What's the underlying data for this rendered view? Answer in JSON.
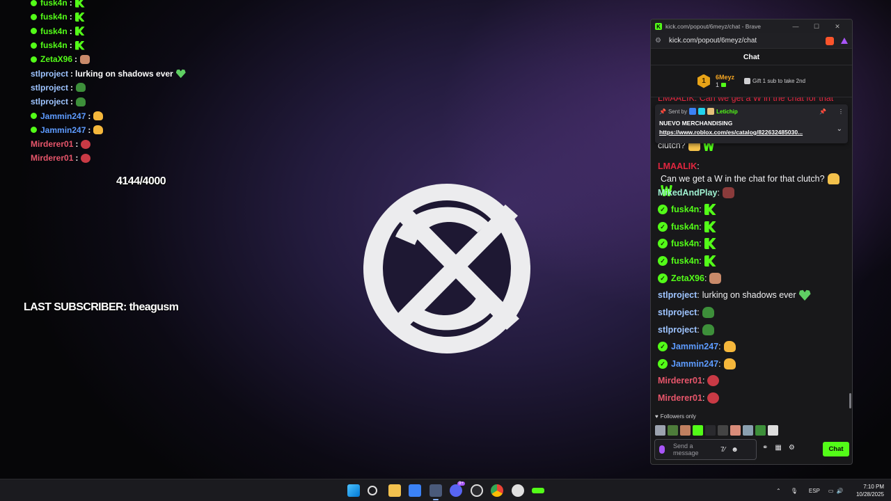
{
  "overlay": {
    "chat": [
      {
        "user": "fusk4n",
        "verified": true,
        "color": "#53fc18",
        "text": "",
        "emote": "kick"
      },
      {
        "user": "fusk4n",
        "verified": true,
        "color": "#53fc18",
        "text": "",
        "emote": "kick"
      },
      {
        "user": "fusk4n",
        "verified": true,
        "color": "#53fc18",
        "text": "",
        "emote": "kick"
      },
      {
        "user": "fusk4n",
        "verified": true,
        "color": "#53fc18",
        "text": "",
        "emote": "kick"
      },
      {
        "user": "ZetaX96",
        "verified": true,
        "color": "#53fc18",
        "text": "",
        "emote": "cat"
      },
      {
        "user": "stlproject",
        "verified": false,
        "color": "#9ec4ff",
        "text": "lurking on shadows ever",
        "emote": "heart"
      },
      {
        "user": "stlproject",
        "verified": false,
        "color": "#9ec4ff",
        "text": "",
        "emote": "pepe"
      },
      {
        "user": "stlproject",
        "verified": false,
        "color": "#9ec4ff",
        "text": "",
        "emote": "pepe"
      },
      {
        "user": "Jammin247",
        "verified": true,
        "color": "#5d9bff",
        "text": "",
        "emote": "duck"
      },
      {
        "user": "Jammin247",
        "verified": true,
        "color": "#5d9bff",
        "text": "",
        "emote": "duck"
      },
      {
        "user": "Mirderer01",
        "verified": false,
        "color": "#e8566b",
        "text": "",
        "emote": "skull"
      },
      {
        "user": "Mirderer01",
        "verified": false,
        "color": "#e8566b",
        "text": "",
        "emote": "skull"
      }
    ],
    "counter": "4144/4000",
    "last_subscriber": "LAST SUBSCRIBER: theagusm"
  },
  "browser": {
    "window_title": "kick.com/popout/6meyz/chat - Brave",
    "url": "kick.com/popout/6meyz/chat",
    "chat_header": "Chat",
    "leaderboard": {
      "rank": "1",
      "user": "6Meyz",
      "count": "1",
      "gift_text": "Gift 1 sub to take 2nd"
    },
    "partial_message": "LMAALIK: Can we get a W in the chat for that",
    "pinned": {
      "sent_by": "Sent by",
      "sender": "Letichip",
      "title": "NUEVO MERCHANDISING",
      "link": "https://www.roblox.com/es/catalog/822632485030..."
    },
    "messages": [
      {
        "user": "",
        "verified": false,
        "color": "#ffffff",
        "text": "clutch?",
        "emotes": [
          "hands",
          "w"
        ]
      },
      {
        "user": "LMAALIK",
        "verified": false,
        "color": "#e2263f",
        "text": "Can we get a W in the chat for that clutch?",
        "emotes": [
          "hands",
          "w"
        ]
      },
      {
        "user": "MikedAndPlay",
        "verified": false,
        "color": "#9ff0d0",
        "text": "",
        "emotes": [
          "face"
        ]
      },
      {
        "user": "fusk4n",
        "verified": true,
        "color": "#53fc18",
        "text": "",
        "emotes": [
          "kick"
        ]
      },
      {
        "user": "fusk4n",
        "verified": true,
        "color": "#53fc18",
        "text": "",
        "emotes": [
          "kick"
        ]
      },
      {
        "user": "fusk4n",
        "verified": true,
        "color": "#53fc18",
        "text": "",
        "emotes": [
          "kick"
        ]
      },
      {
        "user": "fusk4n",
        "verified": true,
        "color": "#53fc18",
        "text": "",
        "emotes": [
          "kick"
        ]
      },
      {
        "user": "ZetaX96",
        "verified": true,
        "color": "#53fc18",
        "text": "",
        "emotes": [
          "cat"
        ]
      },
      {
        "user": "stlproject",
        "verified": false,
        "color": "#9ec4ff",
        "text": "lurking on shadows ever",
        "emotes": [
          "heart"
        ]
      },
      {
        "user": "stlproject",
        "verified": false,
        "color": "#9ec4ff",
        "text": "",
        "emotes": [
          "pepe"
        ]
      },
      {
        "user": "stlproject",
        "verified": false,
        "color": "#9ec4ff",
        "text": "",
        "emotes": [
          "pepe"
        ]
      },
      {
        "user": "Jammin247",
        "verified": true,
        "color": "#5d9bff",
        "text": "",
        "emotes": [
          "duck"
        ]
      },
      {
        "user": "Jammin247",
        "verified": true,
        "color": "#5d9bff",
        "text": "",
        "emotes": [
          "duck"
        ]
      },
      {
        "user": "Mirderer01",
        "verified": false,
        "color": "#e8566b",
        "text": "",
        "emotes": [
          "skull"
        ]
      },
      {
        "user": "Mirderer01",
        "verified": false,
        "color": "#e8566b",
        "text": "",
        "emotes": [
          "skull"
        ]
      }
    ],
    "followers_only": "Followers only",
    "composer_placeholder": "Send a message",
    "chat_button": "Chat"
  },
  "taskbar": {
    "language": "ESP",
    "time": "7:10 PM",
    "date": "10/28/2025",
    "notification_badge": "9+"
  },
  "colors": {
    "kick_green": "#53fc18",
    "chat_bg": "#18181a",
    "taskbar_bg": "#1b1b1f"
  }
}
